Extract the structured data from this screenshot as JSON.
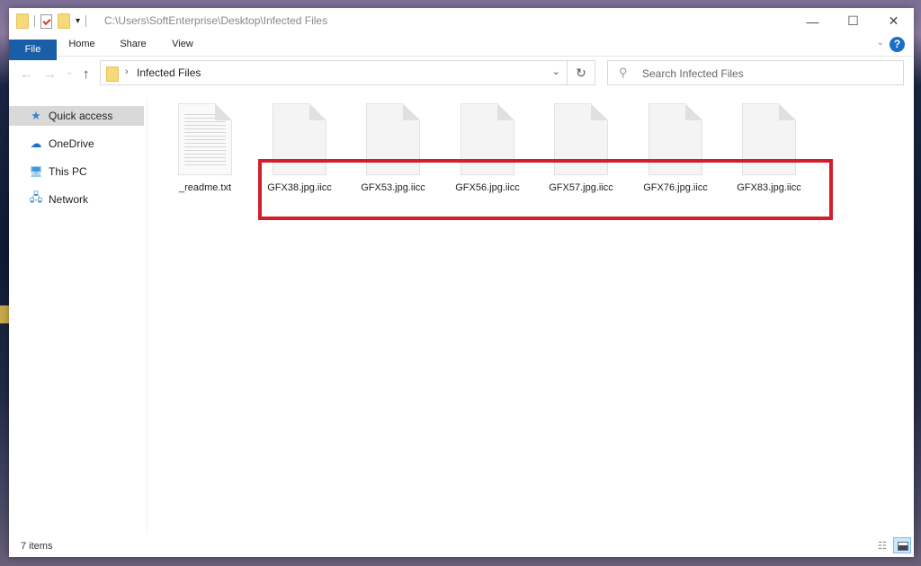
{
  "window": {
    "title_path": "C:\\Users\\SoftEnterprise\\Desktop\\Infected Files",
    "controls": {
      "minimize": "—",
      "maximize": "☐",
      "close": "✕"
    }
  },
  "ribbon": {
    "tabs": [
      {
        "label": "File"
      },
      {
        "label": "Home"
      },
      {
        "label": "Share"
      },
      {
        "label": "View"
      }
    ],
    "help": "?"
  },
  "nav": {
    "back": "←",
    "forward": "→",
    "recent": "⌄",
    "up": "↑",
    "breadcrumb": "Infected Files",
    "breadcrumb_sep": "›",
    "refresh": "↻",
    "search_placeholder": "Search Infected Files"
  },
  "sidebar": {
    "items": [
      {
        "label": "Quick access",
        "icon": "star-icon",
        "glyph": "★",
        "active": true
      },
      {
        "label": "OneDrive",
        "icon": "cloud-icon",
        "glyph": "☁",
        "active": false
      },
      {
        "label": "This PC",
        "icon": "computer-icon",
        "glyph": "🖥",
        "active": false
      },
      {
        "label": "Network",
        "icon": "network-icon",
        "glyph": "🖧",
        "active": false
      }
    ]
  },
  "files": [
    {
      "name": "_readme.txt",
      "type": "text"
    },
    {
      "name": "GFX38.jpg.iicc",
      "type": "encrypted"
    },
    {
      "name": "GFX53.jpg.iicc",
      "type": "encrypted"
    },
    {
      "name": "GFX56.jpg.iicc",
      "type": "encrypted"
    },
    {
      "name": "GFX57.jpg.iicc",
      "type": "encrypted"
    },
    {
      "name": "GFX76.jpg.iicc",
      "type": "encrypted"
    },
    {
      "name": "GFX83.jpg.iicc",
      "type": "encrypted"
    }
  ],
  "annotation": {
    "color": "#d21f2b"
  },
  "status": {
    "item_count": "7 items"
  }
}
